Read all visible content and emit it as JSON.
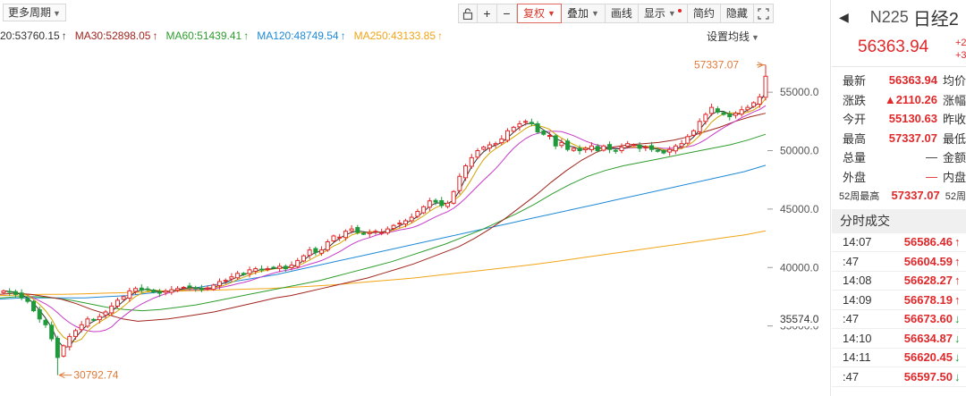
{
  "toolbar": {
    "period_label": "更多周期",
    "buttons": [
      {
        "name": "lock-button",
        "label": "🔓",
        "icon": "lock-icon"
      },
      {
        "name": "zoom-in-button",
        "label": "+",
        "icon": "plus-icon"
      },
      {
        "name": "zoom-out-button",
        "label": "−",
        "icon": "minus-icon"
      },
      {
        "name": "adjust-button",
        "label": "复权"
      },
      {
        "name": "overlay-button",
        "label": "叠加"
      },
      {
        "name": "draw-button",
        "label": "画线"
      },
      {
        "name": "display-button",
        "label": "显示"
      },
      {
        "name": "simple-button",
        "label": "简约"
      },
      {
        "name": "hide-button",
        "label": "隐藏"
      },
      {
        "name": "fullscreen-button",
        "label": "⛶",
        "icon": "fullscreen-icon"
      }
    ]
  },
  "ma_legend": [
    {
      "text": "20:53760.15",
      "arrow": "↑",
      "color": "#333333"
    },
    {
      "text": "MA30:52898.05",
      "arrow": "↑",
      "color": "#a0251e"
    },
    {
      "text": "MA60:51439.41",
      "arrow": "↑",
      "color": "#2e9d2e"
    },
    {
      "text": "MA120:48749.54",
      "arrow": "↑",
      "color": "#1f8ad6"
    },
    {
      "text": "MA250:43133.85",
      "arrow": "↑",
      "color": "#f2a417"
    }
  ],
  "set_ma_label": "设置均线",
  "chart_data": {
    "type": "candlestick",
    "ylim": [
      30000,
      58300
    ],
    "y_ticks": [
      "55000.0",
      "50000.0",
      "45000.0",
      "40000.0",
      "35000.0"
    ],
    "y_tick_values": [
      55000,
      50000,
      45000,
      40000,
      35000
    ],
    "current_label": "35574.0",
    "current_value": 35574,
    "max_label": "57337.07",
    "min_label": "30792.74",
    "high": 57337.07,
    "low": 30792.74,
    "colors": {
      "up": "#e0282a",
      "down": "#1f9a3a",
      "ma5": "#333333",
      "ma10": "#d4a400",
      "ma20": "#c63ac6",
      "ma30": "#a0251e",
      "ma60": "#2e9d2e",
      "ma120": "#1f8ad6",
      "ma250": "#f2a417"
    },
    "closes": [
      38000,
      37900,
      37700,
      37400,
      37100,
      36300,
      35600,
      35100,
      33900,
      32300,
      33300,
      34100,
      34600,
      35100,
      35600,
      35500,
      35800,
      36200,
      36700,
      37200,
      37500,
      38000,
      38200,
      38050,
      38150,
      37900,
      37800,
      38000,
      38100,
      38200,
      38300,
      38350,
      38200,
      38100,
      38250,
      38500,
      38800,
      38900,
      39200,
      39500,
      39400,
      39800,
      39900,
      39800,
      39900,
      40000,
      40100,
      39900,
      40200,
      40600,
      41000,
      41500,
      41300,
      41500,
      42200,
      42700,
      42600,
      43100,
      43300,
      43000,
      42900,
      43000,
      43100,
      43000,
      43300,
      43600,
      43800,
      44000,
      44300,
      44800,
      45200,
      45700,
      45600,
      45300,
      45500,
      46500,
      47800,
      48700,
      49400,
      50000,
      50300,
      50500,
      50600,
      51000,
      51700,
      52000,
      52300,
      52500,
      52300,
      51600,
      51400,
      51300,
      50400,
      50700,
      50100,
      50200,
      50000,
      50200,
      50400,
      50000,
      50400,
      50100,
      50000,
      50300,
      50600,
      50500,
      50200,
      50300,
      50100,
      50000,
      49800,
      50100,
      50400,
      50600,
      51200,
      51700,
      52500,
      53100,
      53700,
      53300,
      53100,
      52900,
      53200,
      53500,
      53700,
      54100,
      54600,
      56364
    ],
    "ma30_points": [
      37700,
      37800,
      37700,
      37500,
      37300,
      36900,
      36400,
      36000,
      35600,
      35400,
      35500,
      35600,
      35800,
      36000,
      36200,
      36500,
      36800,
      37100,
      37400,
      37600,
      37900,
      38200,
      38500,
      38800,
      39100,
      39500,
      39900,
      40300,
      40800,
      41300,
      41800,
      42500,
      43300,
      44200,
      45200,
      46200,
      47300,
      48300,
      49200,
      49900,
      50300,
      50500,
      50600,
      50700,
      50900,
      51200,
      51600,
      52000,
      52500,
      52900,
      53200
    ],
    "ma60_points": [
      37400,
      37500,
      37500,
      37400,
      37200,
      36900,
      36600,
      36400,
      36300,
      36400,
      36600,
      36800,
      37100,
      37400,
      37700,
      38000,
      38300,
      38600,
      38900,
      39300,
      39700,
      40100,
      40500,
      41000,
      41500,
      42000,
      42600,
      43200,
      43900,
      44600,
      45400,
      46300,
      47100,
      47800,
      48300,
      48700,
      49000,
      49300,
      49600,
      49900,
      50200,
      50500,
      50900,
      51400
    ],
    "ma120_points": [
      37300,
      37400,
      37400,
      37400,
      37400,
      37500,
      37600,
      37800,
      38000,
      38200,
      38500,
      38800,
      39100,
      39400,
      39800,
      40200,
      40600,
      41000,
      41400,
      41800,
      42200,
      42600,
      43000,
      43400,
      43800,
      44200,
      44600,
      45000,
      45400,
      45800,
      46200,
      46600,
      47000,
      47400,
      47800,
      48200,
      48750
    ],
    "ma250_points": [
      37600,
      37650,
      37700,
      37700,
      37750,
      37800,
      37850,
      37900,
      37950,
      38000,
      38050,
      38100,
      38150,
      38200,
      38300,
      38400,
      38500,
      38650,
      38800,
      38950,
      39100,
      39300,
      39500,
      39700,
      39900,
      40100,
      40300,
      40550,
      40800,
      41050,
      41300,
      41550,
      41800,
      42050,
      42300,
      42550,
      42800,
      43133
    ]
  },
  "side": {
    "symbol": "N225",
    "name": "日经2",
    "price": "56363.94",
    "change_top": "+2",
    "change_bottom": "+3",
    "stats": [
      {
        "label": "最新",
        "value": "56363.94",
        "label2": "均价"
      },
      {
        "label": "涨跌",
        "value": "▲2110.26",
        "label2": "涨幅"
      },
      {
        "label": "今开",
        "value": "55130.63",
        "label2": "昨收"
      },
      {
        "label": "最高",
        "value": "57337.07",
        "label2": "最低"
      },
      {
        "label": "总量",
        "value": "—",
        "label2": "金额",
        "style": "dash"
      },
      {
        "label": "外盘",
        "value": "—",
        "label2": "内盘",
        "style": "reddash"
      },
      {
        "label": "52周最高",
        "value": "57337.07",
        "label2": "52周",
        "style": "small"
      }
    ],
    "trades_title": "分时成交",
    "trades": [
      {
        "time": "14:07",
        "price": "56586.46",
        "dir": "up"
      },
      {
        "time": ":47",
        "price": "56604.59",
        "dir": "up"
      },
      {
        "time": "14:08",
        "price": "56628.27",
        "dir": "up"
      },
      {
        "time": "14:09",
        "price": "56678.19",
        "dir": "up"
      },
      {
        "time": ":47",
        "price": "56673.60",
        "dir": "down"
      },
      {
        "time": "14:10",
        "price": "56634.87",
        "dir": "down"
      },
      {
        "time": "14:11",
        "price": "56620.45",
        "dir": "down"
      },
      {
        "time": ":47",
        "price": "56597.50",
        "dir": "down"
      }
    ]
  }
}
